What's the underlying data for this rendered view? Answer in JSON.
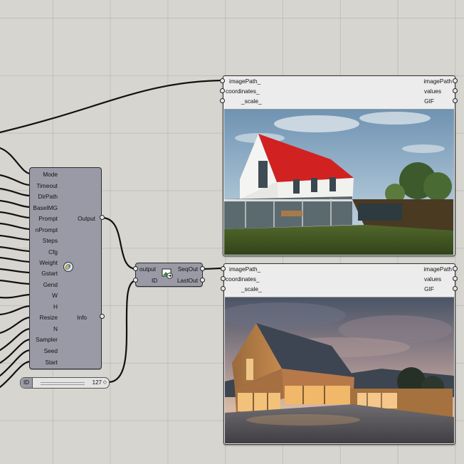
{
  "main_component": {
    "inputs": [
      "Mode",
      "Timeout",
      "DirPath",
      "BaseIMG",
      "Prompt",
      "nPrompt",
      "Steps",
      "Cfg",
      "Weight",
      "Gstart",
      "Gend",
      "W",
      "H",
      "Resize",
      "N",
      "Sampler",
      "Seed",
      "Start"
    ],
    "outputs": {
      "output": "Output",
      "info": "Info"
    },
    "icon": "ai-render-icon"
  },
  "seq_component": {
    "inputs": {
      "output": "output",
      "id": "ID"
    },
    "outputs": {
      "seq_out": "SeqOut",
      "last_out": "LastOut"
    },
    "icon": "image-sequence-icon"
  },
  "slider": {
    "label": "ID",
    "value": "127",
    "marker": "◇"
  },
  "viewers": [
    {
      "inputs": {
        "image_path": "imagePath_",
        "coordinates": "coordinates_",
        "scale": "_scale_"
      },
      "outputs": {
        "image_path": "imagePath",
        "values": "values",
        "gif": "GIF"
      },
      "image": "white-house-red-roof-render"
    },
    {
      "inputs": {
        "image_path": "imagePath_",
        "coordinates": "coordinates_",
        "scale": "_scale_"
      },
      "outputs": {
        "image_path": "imagePath",
        "values": "values",
        "gif": "GIF"
      },
      "image": "timber-house-dusk-render"
    }
  ]
}
